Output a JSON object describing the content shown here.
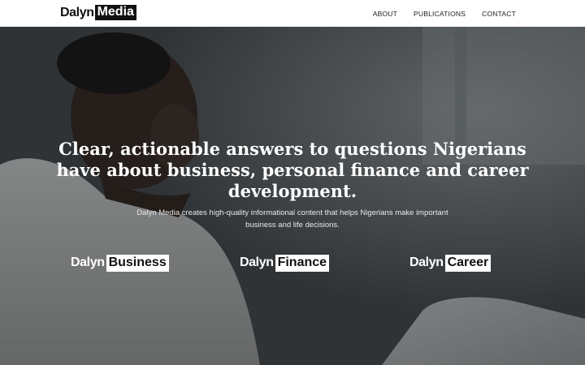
{
  "brand": {
    "word": "Dalyn",
    "boxed": "Media"
  },
  "nav": {
    "items": [
      "ABOUT",
      "PUBLICATIONS",
      "CONTACT"
    ]
  },
  "hero": {
    "headline": "Clear, actionable answers to questions Nigerians have about business, personal finance and career development.",
    "subtext": "Dalyn Media creates high-quality informational content that helps Nigerians make important business and life decisions."
  },
  "publications": [
    {
      "lead": "Dalyn",
      "tag": "Business"
    },
    {
      "lead": "Dalyn",
      "tag": "Finance"
    },
    {
      "lead": "Dalyn",
      "tag": "Career"
    }
  ],
  "colors": {
    "text_dark": "#111111",
    "hero_overlay": "#3b3e41",
    "white": "#ffffff"
  }
}
